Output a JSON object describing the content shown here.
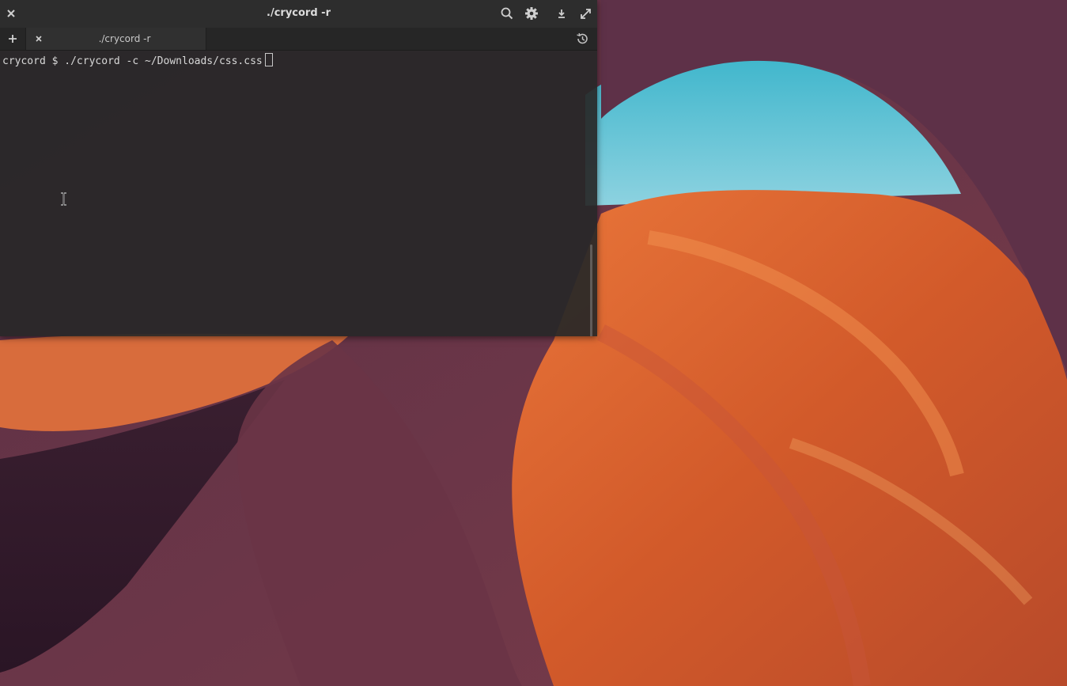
{
  "window": {
    "title": "./crycord -r",
    "close_icon": "close-icon",
    "search_icon": "search-icon",
    "settings_icon": "gear-icon",
    "download_icon": "download-icon",
    "fullscreen_icon": "fullscreen-icon"
  },
  "tabs": {
    "new_tab_icon": "plus-icon",
    "items": [
      {
        "label": "./crycord -r",
        "close_icon": "close-icon"
      }
    ],
    "history_icon": "history-icon"
  },
  "terminal": {
    "prompt": "crycord $ ",
    "command": "./crycord -c ~/Downloads/css.css"
  },
  "colors": {
    "titlebar": "#2d2d2d",
    "terminal_bg": "#282828",
    "text": "#d8d8d8"
  }
}
